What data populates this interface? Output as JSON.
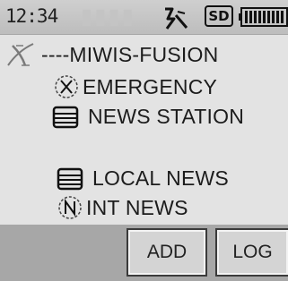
{
  "status_bar": {
    "time": "12:34",
    "signal_icon": "signal-strength-icon",
    "sd_label": "SD",
    "battery_icon": "battery-icon"
  },
  "list": {
    "header_icon": "wires-x-logo-icon",
    "header": "----MIWIS-FUSION",
    "items": [
      {
        "icon": "x-circle-icon",
        "label": "EMERGENCY"
      },
      {
        "icon": "list-icon",
        "label": "NEWS STATION"
      },
      {
        "icon": "list-icon",
        "label": "LOCAL NEWS"
      },
      {
        "icon": "n-circle-icon",
        "label": "INT NEWS"
      }
    ]
  },
  "softkeys": {
    "add": "ADD",
    "log": "LOG"
  },
  "colors": {
    "screen_bg": "#e3e3e3",
    "softkey_bar_bg": "#a7a7a7",
    "text": "#1c1c1c"
  }
}
